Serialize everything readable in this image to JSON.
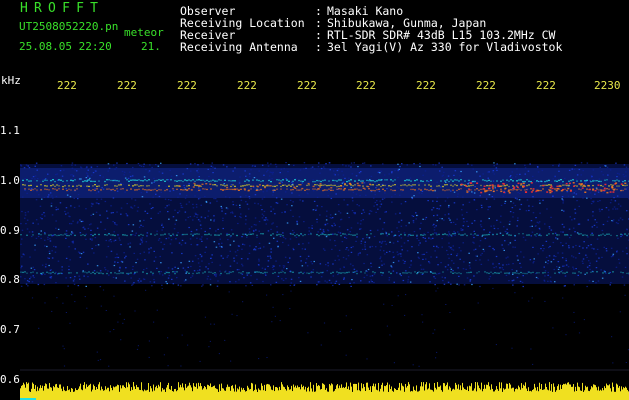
{
  "header": {
    "app_title": "HROFFT",
    "file_name": "UT2508052220.pn",
    "event_type": "meteor",
    "timestamp": "25.08.05 22:20",
    "event_index": "21."
  },
  "station_info": [
    {
      "key": "Observer",
      "value": "Masaki Kano"
    },
    {
      "key": "Receiving Location",
      "value": "Shibukawa, Gunma, Japan"
    },
    {
      "key": "Receiver",
      "value": "RTL-SDR SDR# 43dB L15 103.2MHz CW"
    },
    {
      "key": "Receiving Antenna",
      "value": "3el Yagi(V) Az 330 for Vladivostok"
    }
  ],
  "axes": {
    "unit_label": "kHz",
    "y_ticks": [
      "1.1",
      "1.0",
      "0.9",
      "0.8",
      "0.7",
      "0.6"
    ],
    "x_ticks": [
      "222",
      "222",
      "222",
      "222",
      "222",
      "222",
      "222",
      "222",
      "222",
      "2230"
    ]
  },
  "colors": {
    "label_green": "#39e02a",
    "tick_yellow": "#e8e84a",
    "background": "#000000",
    "noise_blue": "#1a3cd8",
    "signal_orange": "#ff7a1a",
    "signal_yellow": "#f0e020",
    "signal_cyan": "#20e0e0"
  }
}
